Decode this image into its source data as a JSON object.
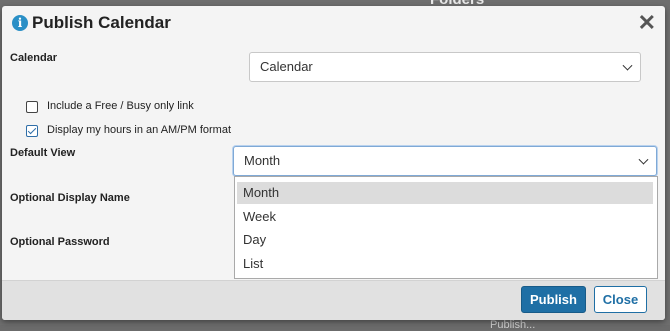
{
  "background": {
    "folders_text": "Folders",
    "bottom_text": "Publish..."
  },
  "dialog": {
    "title": "Publish Calendar",
    "icons": {
      "info": "info-icon",
      "close": "close-icon"
    },
    "calendar": {
      "label": "Calendar",
      "value": "Calendar"
    },
    "checkboxes": [
      {
        "label": "Include a Free / Busy only link",
        "checked": false
      },
      {
        "label": "Display my hours in an AM/PM format",
        "checked": true
      }
    ],
    "default_view": {
      "label": "Default View",
      "value": "Month",
      "options": [
        "Month",
        "Week",
        "Day",
        "List"
      ],
      "highlighted": "Month"
    },
    "optional_display_name": {
      "label": "Optional Display Name"
    },
    "optional_password": {
      "label": "Optional Password"
    },
    "buttons": {
      "publish": "Publish",
      "close": "Close"
    }
  },
  "colors": {
    "accent": "#1f6fa5",
    "info_icon": "#2a8fc6",
    "footer": "#e1e1e1"
  }
}
